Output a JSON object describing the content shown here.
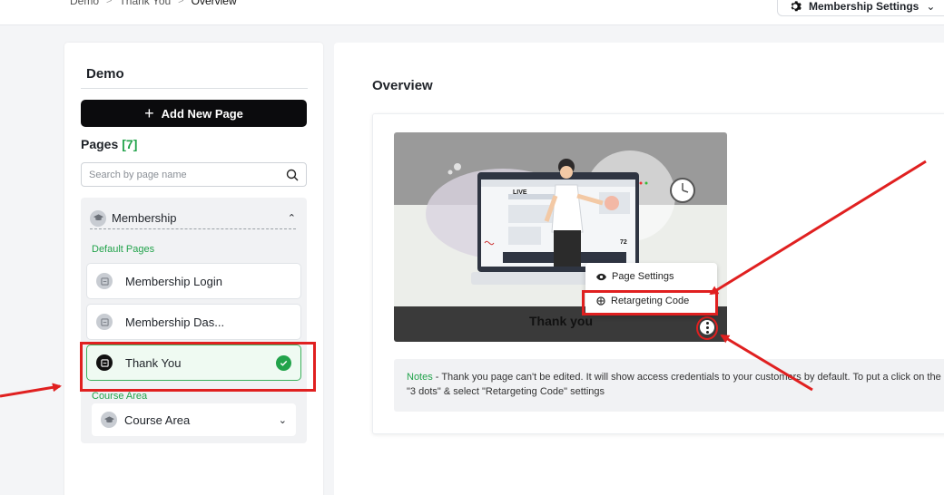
{
  "breadcrumb": [
    "Demo",
    "Thank You",
    "Overview"
  ],
  "header": {
    "settings_label": "Membership Settings"
  },
  "sidebar": {
    "site_title": "Demo",
    "add_button": "Add New Page",
    "pages_label": "Pages",
    "pages_count": "[7]",
    "search_placeholder": "Search by page name",
    "group_label": "Membership",
    "default_pages_label": "Default Pages",
    "items": [
      {
        "label": "Membership Login"
      },
      {
        "label": "Membership Das..."
      },
      {
        "label": "Thank You"
      }
    ],
    "course_area_label": "Course Area",
    "course_item": "Course Area"
  },
  "main": {
    "title": "Overview",
    "thumb_title": "Thank you",
    "live_label": "LIVE",
    "viewer_count": "72",
    "menu": [
      "Page Settings",
      "Retargeting Code"
    ],
    "notes_label": "Notes",
    "notes_text": " - Thank you page can't be edited. It will show access credentials to your customers by default. To put a click on the \"3 dots\" & select \"Retargeting Code\" settings"
  },
  "colors": {
    "accent": "#22a34b",
    "annotation": "#e02020",
    "button": "#0b0b0d"
  }
}
